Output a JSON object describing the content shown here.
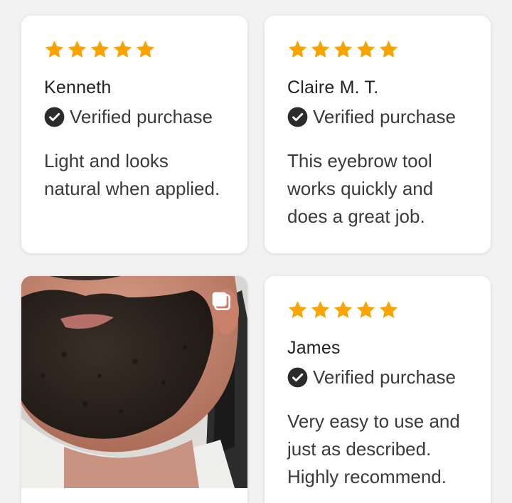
{
  "colors": {
    "star": "#F7A400",
    "page_bg": "#f2f2f2",
    "card_bg": "#ffffff",
    "check_bg": "#2b2b2b"
  },
  "reviews": [
    {
      "rating": 5,
      "reviewer": "Kenneth",
      "verified_label": "Verified purchase",
      "text": "Light and looks natural when applied."
    },
    {
      "rating": 5,
      "reviewer": "Claire M. T.",
      "verified_label": "Verified purchase",
      "text": "This eyebrow tool works quickly and does a great job."
    },
    {
      "photo": "customer-photo-beard",
      "icon": "gallery-icon"
    },
    {
      "rating": 5,
      "reviewer": "James",
      "verified_label": "Verified purchase",
      "text": "Very easy to use and just as described. Highly recommend."
    }
  ]
}
